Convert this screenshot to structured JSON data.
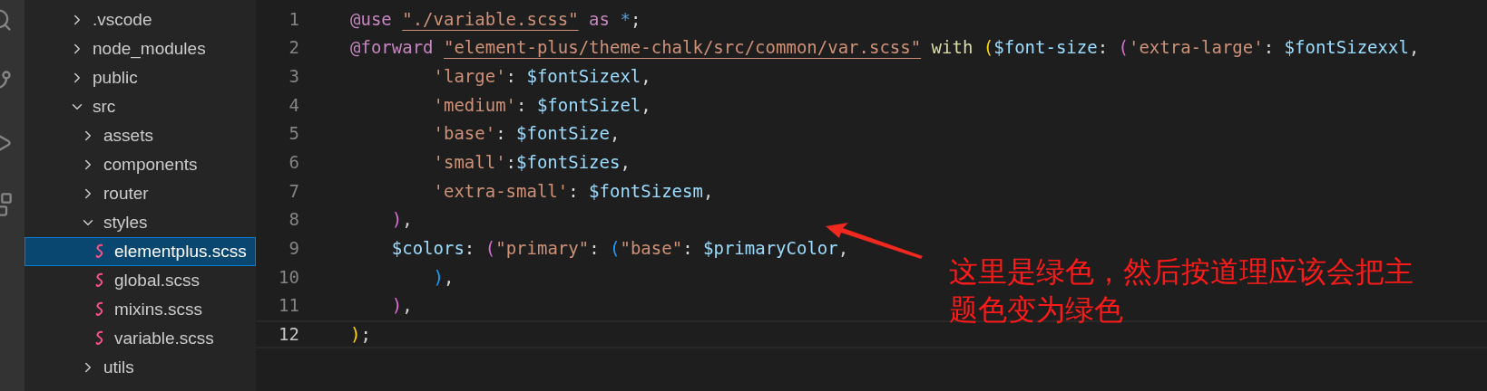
{
  "explorer": {
    "items": [
      {
        "label": ".vscode",
        "kind": "folder",
        "expanded": false,
        "selected": false
      },
      {
        "label": "node_modules",
        "kind": "folder",
        "expanded": false,
        "selected": false
      },
      {
        "label": "public",
        "kind": "folder",
        "expanded": false,
        "selected": false
      },
      {
        "label": "src",
        "kind": "folder",
        "expanded": true,
        "selected": false,
        "children": [
          {
            "label": "assets",
            "kind": "folder",
            "expanded": false,
            "selected": false
          },
          {
            "label": "components",
            "kind": "folder",
            "expanded": false,
            "selected": false
          },
          {
            "label": "router",
            "kind": "folder",
            "expanded": false,
            "selected": false
          },
          {
            "label": "styles",
            "kind": "folder",
            "expanded": true,
            "selected": false,
            "children": [
              {
                "label": "elementplus.scss",
                "kind": "scss",
                "selected": true
              },
              {
                "label": "global.scss",
                "kind": "scss",
                "selected": false
              },
              {
                "label": "mixins.scss",
                "kind": "scss",
                "selected": false
              },
              {
                "label": "variable.scss",
                "kind": "scss",
                "selected": false
              }
            ]
          },
          {
            "label": "utils",
            "kind": "folder",
            "expanded": false,
            "selected": false
          }
        ]
      }
    ]
  },
  "editor": {
    "lines": [
      {
        "number": "1",
        "current": false,
        "tokens": [
          {
            "t": "@use ",
            "kind": "keyword"
          },
          {
            "t": "\"./variable.scss\"",
            "kind": "link"
          },
          {
            "t": " as",
            "kind": "keyword"
          },
          {
            "t": " *",
            "kind": "operator"
          },
          {
            "t": ";",
            "kind": "plain"
          }
        ]
      },
      {
        "number": "2",
        "current": false,
        "tokens": [
          {
            "t": "@forward ",
            "kind": "keyword"
          },
          {
            "t": "\"element-plus/theme-chalk/src/common/var.scss\"",
            "kind": "link"
          },
          {
            "t": " with",
            "kind": "function"
          },
          {
            "t": " (",
            "kind": "bracket1"
          },
          {
            "t": "$font-size",
            "kind": "variable"
          },
          {
            "t": ": ",
            "kind": "plain"
          },
          {
            "t": "(",
            "kind": "bracket2"
          },
          {
            "t": "'extra-large'",
            "kind": "string"
          },
          {
            "t": ": ",
            "kind": "plain"
          },
          {
            "t": "$fontSizexxl",
            "kind": "variable"
          },
          {
            "t": ",",
            "kind": "plain"
          }
        ]
      },
      {
        "number": "3",
        "current": false,
        "tokens": [
          {
            "t": "        'large'",
            "kind": "string"
          },
          {
            "t": ": ",
            "kind": "plain"
          },
          {
            "t": "$fontSizexl",
            "kind": "variable"
          },
          {
            "t": ",",
            "kind": "plain"
          }
        ]
      },
      {
        "number": "4",
        "current": false,
        "tokens": [
          {
            "t": "        'medium'",
            "kind": "string"
          },
          {
            "t": ": ",
            "kind": "plain"
          },
          {
            "t": "$fontSizel",
            "kind": "variable"
          },
          {
            "t": ",",
            "kind": "plain"
          }
        ]
      },
      {
        "number": "5",
        "current": false,
        "tokens": [
          {
            "t": "        'base'",
            "kind": "string"
          },
          {
            "t": ": ",
            "kind": "plain"
          },
          {
            "t": "$fontSize",
            "kind": "variable"
          },
          {
            "t": ",",
            "kind": "plain"
          }
        ]
      },
      {
        "number": "6",
        "current": false,
        "tokens": [
          {
            "t": "        'small'",
            "kind": "string"
          },
          {
            "t": ":",
            "kind": "plain"
          },
          {
            "t": "$fontSizes",
            "kind": "variable"
          },
          {
            "t": ",",
            "kind": "plain"
          }
        ]
      },
      {
        "number": "7",
        "current": false,
        "tokens": [
          {
            "t": "        'extra-small'",
            "kind": "string"
          },
          {
            "t": ": ",
            "kind": "plain"
          },
          {
            "t": "$fontSizesm",
            "kind": "variable"
          },
          {
            "t": ",",
            "kind": "plain"
          }
        ]
      },
      {
        "number": "8",
        "current": false,
        "tokens": [
          {
            "t": "    )",
            "kind": "bracket2"
          },
          {
            "t": ",",
            "kind": "plain"
          }
        ]
      },
      {
        "number": "9",
        "current": false,
        "tokens": [
          {
            "t": "    $colors",
            "kind": "variable"
          },
          {
            "t": ": ",
            "kind": "plain"
          },
          {
            "t": "(",
            "kind": "bracket2"
          },
          {
            "t": "\"primary\"",
            "kind": "string"
          },
          {
            "t": ": ",
            "kind": "plain"
          },
          {
            "t": "(",
            "kind": "bracket3"
          },
          {
            "t": "\"base\"",
            "kind": "string"
          },
          {
            "t": ": ",
            "kind": "plain"
          },
          {
            "t": "$primaryColor",
            "kind": "variable"
          },
          {
            "t": ",",
            "kind": "plain"
          }
        ]
      },
      {
        "number": "10",
        "current": false,
        "tokens": [
          {
            "t": "        )",
            "kind": "bracket3"
          },
          {
            "t": ",",
            "kind": "plain"
          }
        ]
      },
      {
        "number": "11",
        "current": false,
        "tokens": [
          {
            "t": "    )",
            "kind": "bracket2"
          },
          {
            "t": ",",
            "kind": "plain"
          }
        ]
      },
      {
        "number": "12",
        "current": true,
        "tokens": [
          {
            "t": ")",
            "kind": "bracket1"
          },
          {
            "t": ";",
            "kind": "plain"
          }
        ]
      }
    ]
  },
  "annotation": {
    "text": "这里是绿色，然后按道理应该会把主题色变为绿色"
  }
}
